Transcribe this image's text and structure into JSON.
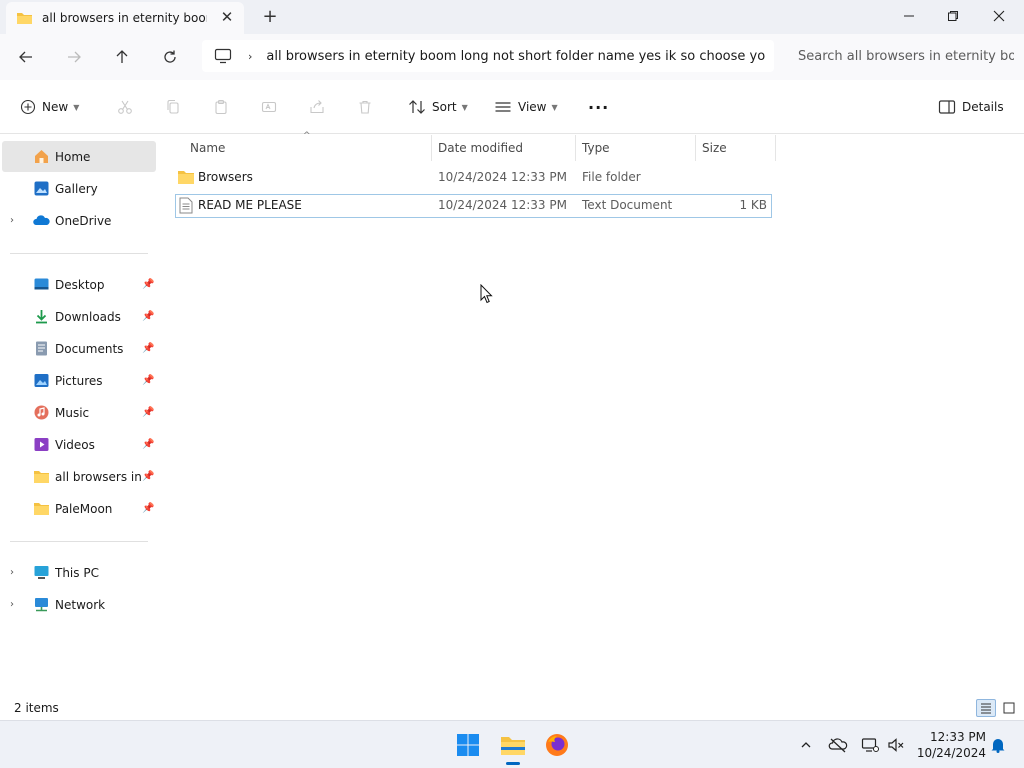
{
  "window": {
    "tab_title": "all browsers in eternity boom l",
    "new_tab": "+"
  },
  "address": {
    "path": "all browsers in eternity boom long not short folder name yes ik so choose yo",
    "search_placeholder": "Search all browsers in eternity bo"
  },
  "toolbar": {
    "new_label": "New",
    "sort_label": "Sort",
    "view_label": "View",
    "more_label": "···",
    "details_label": "Details"
  },
  "sidebar": {
    "quick": [
      {
        "label": "Home",
        "icon": "home-icon"
      },
      {
        "label": "Gallery",
        "icon": "gallery-icon"
      },
      {
        "label": "OneDrive",
        "icon": "onedrive-icon"
      }
    ],
    "pinned": [
      {
        "label": "Desktop",
        "icon": "desktop-icon"
      },
      {
        "label": "Downloads",
        "icon": "downloads-icon"
      },
      {
        "label": "Documents",
        "icon": "documents-icon"
      },
      {
        "label": "Pictures",
        "icon": "pictures-icon"
      },
      {
        "label": "Music",
        "icon": "music-icon"
      },
      {
        "label": "Videos",
        "icon": "videos-icon"
      },
      {
        "label": "all browsers in eternity boom long not short folder name yes ik so choose yo",
        "icon": "folder-icon"
      },
      {
        "label": "PaleMoon",
        "icon": "folder-icon"
      }
    ],
    "devices": [
      {
        "label": "This PC",
        "icon": "this-pc-icon"
      },
      {
        "label": "Network",
        "icon": "network-icon"
      }
    ]
  },
  "columns": {
    "name": "Name",
    "date": "Date modified",
    "type": "Type",
    "size": "Size"
  },
  "files": [
    {
      "name": "Browsers",
      "date": "10/24/2024 12:33 PM",
      "type": "File folder",
      "size": "",
      "icon": "folder-icon"
    },
    {
      "name": "READ ME PLEASE",
      "date": "10/24/2024 12:33 PM",
      "type": "Text Document",
      "size": "1 KB",
      "icon": "text-file-icon"
    }
  ],
  "status": {
    "item_count": "2 items"
  },
  "taskbar": {
    "time": "12:33 PM",
    "date": "10/24/2024"
  },
  "colors": {
    "accent": "#0067c0",
    "folder": "#f5c242",
    "selection": "#e6e6e6",
    "focus_border": "#9fc7e6"
  }
}
